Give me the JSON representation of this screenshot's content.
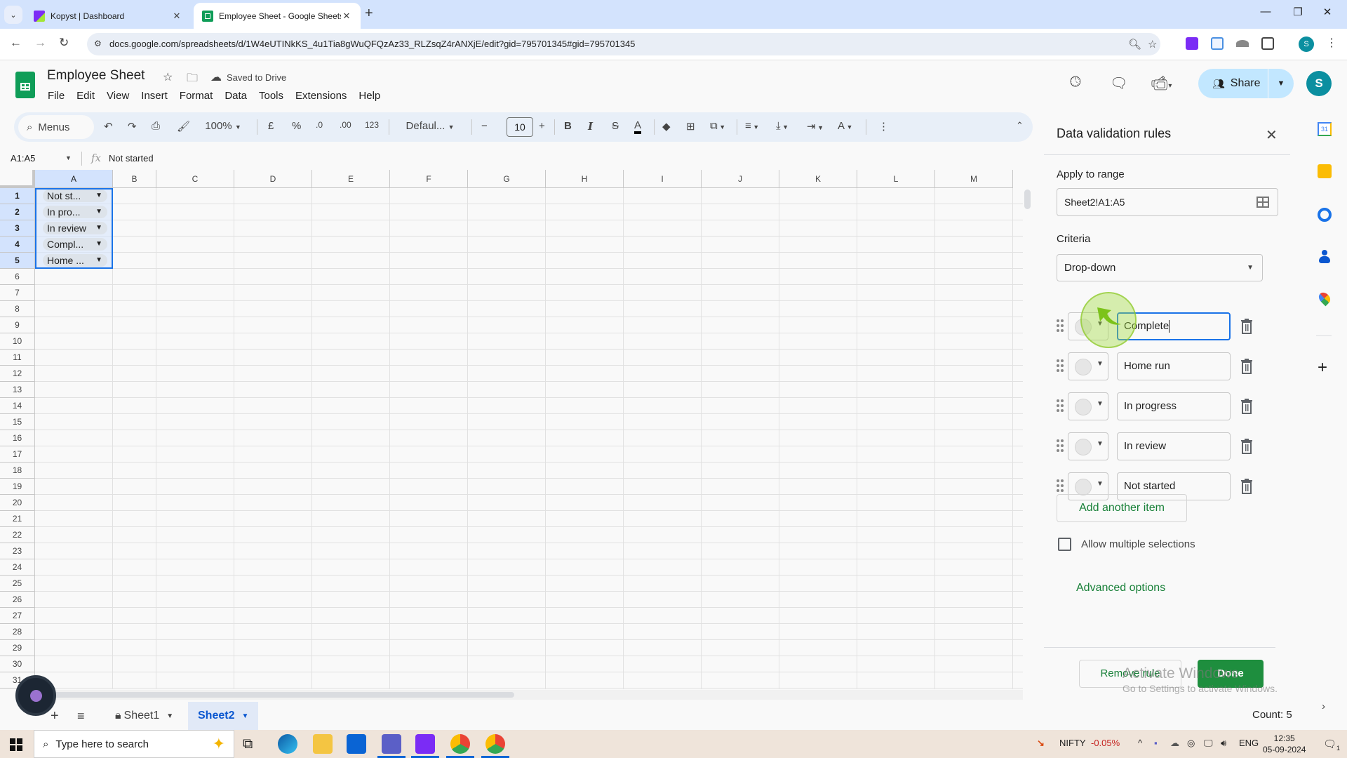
{
  "browser": {
    "tabs": [
      {
        "title": "Kopyst | Dashboard",
        "active": false
      },
      {
        "title": "Employee Sheet - Google Sheets",
        "active": true
      }
    ],
    "url": "docs.google.com/spreadsheets/d/1W4eUTINkKS_4u1Tia8gWuQFQzAz33_RLZsqZ4rANXjE/edit?gid=795701345#gid=795701345",
    "profile_initial": "S"
  },
  "header": {
    "doc_title": "Employee Sheet",
    "save_status": "Saved to Drive",
    "menu": [
      "File",
      "Edit",
      "View",
      "Insert",
      "Format",
      "Data",
      "Tools",
      "Extensions",
      "Help"
    ],
    "share_label": "Share",
    "avatar_initial": "S"
  },
  "toolbar": {
    "menus_label": "Menus",
    "zoom": "100%",
    "currency": "£",
    "percent": "%",
    "dec_decrease": ".0",
    "dec_increase": ".00",
    "number_format": "123",
    "font": "Defaul...",
    "font_size": "10",
    "bold": "B",
    "italic": "I"
  },
  "formula_bar": {
    "name_box": "A1:A5",
    "fx": "fx",
    "value": "Not started"
  },
  "grid": {
    "columns": [
      "A",
      "B",
      "C",
      "D",
      "E",
      "F",
      "G",
      "H",
      "I",
      "J",
      "K",
      "L",
      "M"
    ],
    "rows": [
      "1",
      "2",
      "3",
      "4",
      "5",
      "6",
      "7",
      "8",
      "9",
      "10",
      "11",
      "12",
      "13",
      "14",
      "15",
      "16",
      "17",
      "18",
      "19",
      "20",
      "21",
      "22",
      "23",
      "24",
      "25",
      "26",
      "27",
      "28",
      "29",
      "30",
      "31"
    ],
    "cells_A": [
      "Not st...",
      "In pro...",
      "In review",
      "Compl...",
      "Home ..."
    ]
  },
  "sheets": {
    "tabs": [
      {
        "name": "Sheet1",
        "locked": true,
        "active": false
      },
      {
        "name": "Sheet2",
        "locked": false,
        "active": true
      }
    ],
    "status": "Count: 5"
  },
  "panel": {
    "title": "Data validation rules",
    "apply_label": "Apply to range",
    "range": "Sheet2!A1:A5",
    "criteria_label": "Criteria",
    "criteria": "Drop-down",
    "items": [
      "Complete",
      "Home run",
      "In progress",
      "In review",
      "Not started"
    ],
    "add_item": "Add another item",
    "allow_multiple": "Allow multiple selections",
    "allow_multiple_checked": false,
    "advanced": "Advanced options",
    "remove_rule": "Remove rule",
    "done": "Done"
  },
  "watermark": {
    "line1": "Activate Windows",
    "line2": "Go to Settings to activate Windows."
  },
  "taskbar": {
    "search_placeholder": "Type here to search",
    "ticker": "NIFTY",
    "ticker_change": "-0.05%",
    "lang": "ENG",
    "time": "12:35",
    "date": "05-09-2024",
    "notifications": "1"
  }
}
